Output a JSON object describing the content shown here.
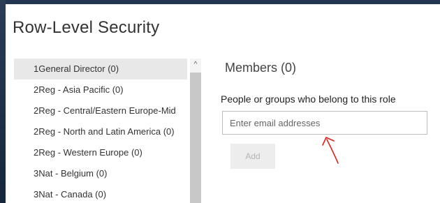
{
  "dialog": {
    "title": "Row-Level Security"
  },
  "roles": [
    {
      "label": "1General Director (0)",
      "selected": true
    },
    {
      "label": "2Reg - Asia Pacific (0)"
    },
    {
      "label": "2Reg - Central/Eastern Europe-Mid"
    },
    {
      "label": "2Reg - North and Latin America (0)"
    },
    {
      "label": "2Reg - Western Europe (0)"
    },
    {
      "label": "3Nat - Belgium (0)"
    },
    {
      "label": "3Nat - Canada (0)"
    }
  ],
  "scrollbar": {
    "up_icon": "chevron-up-icon",
    "up_glyph": "^"
  },
  "members": {
    "title": "Members (0)",
    "label": "People or groups who belong to this role",
    "email_value": "",
    "email_placeholder": "Enter email addresses",
    "add_label": "Add"
  },
  "colors": {
    "annotation": "#e0201a",
    "selected_row": "#e8e8e8",
    "scroll_thumb": "#c8c8c8",
    "add_disabled_text": "#b4b4b4"
  },
  "annotation": {
    "icon": "red-arrow-icon"
  }
}
